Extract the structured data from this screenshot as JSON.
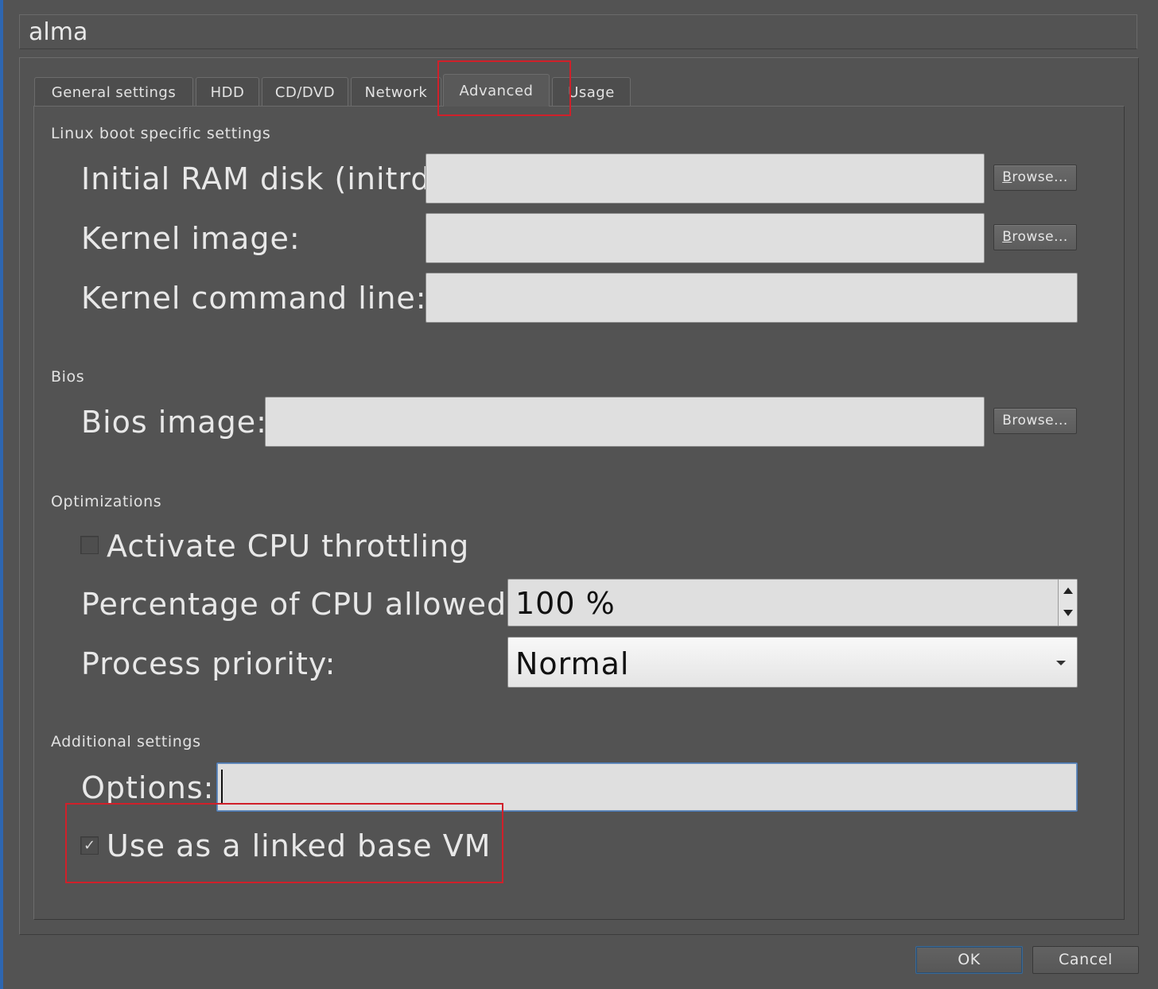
{
  "vm": {
    "name": "alma"
  },
  "tabs": [
    {
      "label": "General settings"
    },
    {
      "label": "HDD"
    },
    {
      "label": "CD/DVD"
    },
    {
      "label": "Network"
    },
    {
      "label": "Advanced"
    },
    {
      "label": "Usage"
    }
  ],
  "active_tab": "Advanced",
  "linux_boot": {
    "title": "Linux boot specific settings",
    "initrd_label": "Initial RAM disk (initrd):",
    "initrd_value": "",
    "kernel_label": "Kernel image:",
    "kernel_value": "",
    "cmdline_label": "Kernel command line:",
    "cmdline_value": "",
    "browse_mnemonic": "B",
    "browse_rest": "rowse..."
  },
  "bios": {
    "title": "Bios",
    "image_label": "Bios image:",
    "image_value": "",
    "browse_label": "Browse..."
  },
  "optimizations": {
    "title": "Optimizations",
    "cpu_throttling_label": "Activate CPU throttling",
    "cpu_throttling_checked": false,
    "cpu_percent_label": "Percentage of CPU allowed:",
    "cpu_percent_value": "100 %",
    "priority_label": "Process priority:",
    "priority_value": "Normal"
  },
  "additional": {
    "title": "Additional settings",
    "options_label": "Options:",
    "options_value": "",
    "linked_base_label": "Use as a linked base VM",
    "linked_base_checked": true,
    "check_glyph": "✓"
  },
  "buttons": {
    "ok": "OK",
    "cancel": "Cancel"
  },
  "colors": {
    "background": "#535353",
    "field": "#dfdfdf",
    "highlight": "#d0202a",
    "focus": "#4a7ab8"
  }
}
